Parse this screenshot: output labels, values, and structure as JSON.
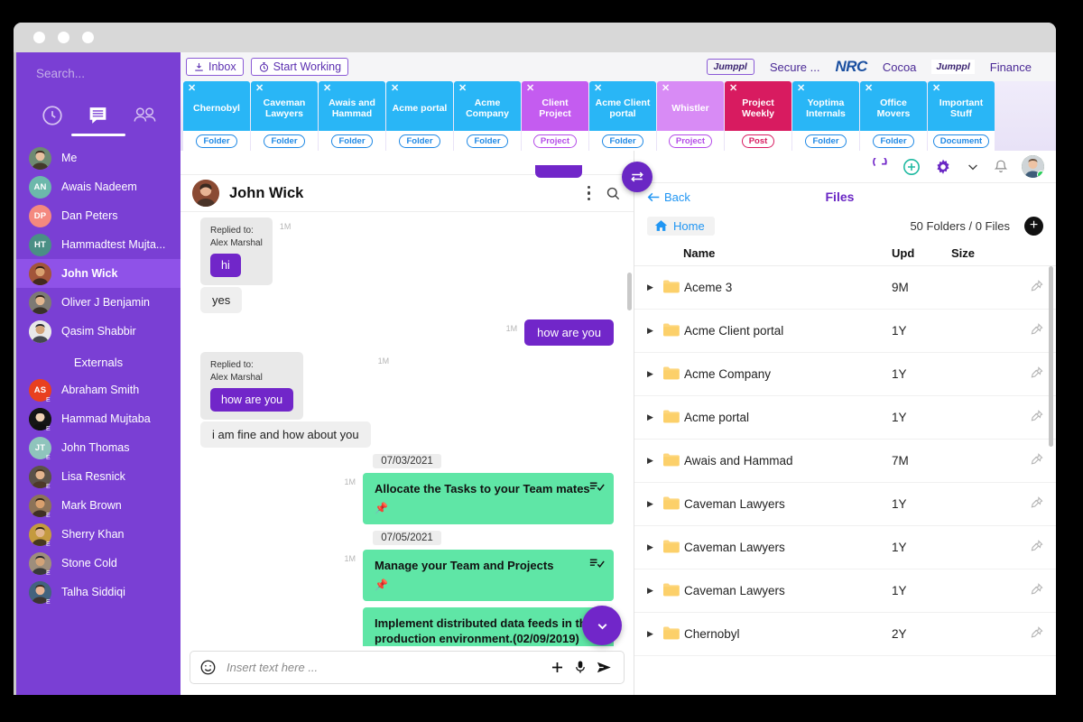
{
  "sidebar": {
    "search_placeholder": "Search...",
    "tabs": [
      {
        "name": "timer-tab",
        "label": "Timer"
      },
      {
        "name": "chat-tab",
        "label": "Chat",
        "active": true
      },
      {
        "name": "people-tab",
        "label": "People"
      }
    ],
    "contacts": [
      {
        "name": "Me",
        "initials": "",
        "color": "#6e8a72",
        "photo": true
      },
      {
        "name": "Awais Nadeem",
        "initials": "AN",
        "color": "#6cb8ab",
        "photo": false
      },
      {
        "name": "Dan Peters",
        "initials": "DP",
        "color": "#f4897f",
        "photo": false
      },
      {
        "name": "Hammadtest Mujta...",
        "initials": "HT",
        "color": "#4a8f85",
        "photo": false
      },
      {
        "name": "John Wick",
        "initials": "",
        "color": "#a2553a",
        "photo": true,
        "active": true
      },
      {
        "name": "Oliver J Benjamin",
        "initials": "",
        "color": "#7d7a74",
        "photo": true
      },
      {
        "name": "Qasim Shabbir",
        "initials": "",
        "color": "#e8e8e8",
        "photo": true
      }
    ],
    "externals_title": "Externals",
    "externals": [
      {
        "name": "Abraham Smith",
        "initials": "AS",
        "color": "#e8401f",
        "photo": false,
        "badge": "E"
      },
      {
        "name": "Hammad Mujtaba",
        "initials": "",
        "color": "#161616",
        "photo": true,
        "badge": "E"
      },
      {
        "name": "John Thomas",
        "initials": "JT",
        "color": "#8fc4bc",
        "photo": false,
        "badge": "E"
      },
      {
        "name": "Lisa Resnick",
        "initials": "",
        "color": "#5c5248",
        "photo": true,
        "badge": "E"
      },
      {
        "name": "Mark Brown",
        "initials": "",
        "color": "#8d7358",
        "photo": true,
        "badge": "E"
      },
      {
        "name": "Sherry Khan",
        "initials": "",
        "color": "#c49a3f",
        "photo": true,
        "badge": "E"
      },
      {
        "name": "Stone Cold",
        "initials": "",
        "color": "#9e8e7c",
        "photo": true,
        "badge": "E"
      },
      {
        "name": "Talha Siddiqi",
        "initials": "",
        "color": "#43637e",
        "photo": true,
        "badge": "E"
      }
    ]
  },
  "toolbar": {
    "inbox_label": "Inbox",
    "start_working_label": "Start Working",
    "brands": [
      {
        "text": "Jumppl",
        "style": "chip"
      },
      {
        "text": "Secure ...",
        "style": "plain-link"
      },
      {
        "text": "NRC",
        "style": "nrc"
      },
      {
        "text": "Cocoa",
        "style": "plain-link"
      },
      {
        "text": "Jumppl",
        "style": "white"
      },
      {
        "text": "Finance",
        "style": "plain-link"
      }
    ]
  },
  "doc_tabs": [
    {
      "title": "Chernobyl",
      "kind": "Folder",
      "color": "#29b6f6",
      "kind_color": "#1e88e5"
    },
    {
      "title": "Caveman Lawyers",
      "kind": "Folder",
      "color": "#29b6f6",
      "kind_color": "#1e88e5"
    },
    {
      "title": "Awais and Hammad",
      "kind": "Folder",
      "color": "#29b6f6",
      "kind_color": "#1e88e5"
    },
    {
      "title": "Acme portal",
      "kind": "Folder",
      "color": "#29b6f6",
      "kind_color": "#1e88e5"
    },
    {
      "title": "Acme Company",
      "kind": "Folder",
      "color": "#29b6f6",
      "kind_color": "#1e88e5"
    },
    {
      "title": "Client Project",
      "kind": "Project",
      "color": "#c45cf0",
      "kind_color": "#b44ae8"
    },
    {
      "title": "Acme Client portal",
      "kind": "Folder",
      "color": "#29b6f6",
      "kind_color": "#1e88e5"
    },
    {
      "title": "Whistler",
      "kind": "Project",
      "color": "#d88bf5",
      "kind_color": "#b44ae8"
    },
    {
      "title": "Project Weekly",
      "kind": "Post",
      "color": "#d81b60",
      "kind_color": "#d81b60"
    },
    {
      "title": "Yoptima Internals",
      "kind": "Folder",
      "color": "#29b6f6",
      "kind_color": "#1e88e5"
    },
    {
      "title": "Office Movers",
      "kind": "Folder",
      "color": "#29b6f6",
      "kind_color": "#1e88e5"
    },
    {
      "title": "Important Stuff",
      "kind": "Document",
      "color": "#29b6f6",
      "kind_color": "#1e88e5"
    }
  ],
  "chat": {
    "title": "John Wick",
    "messages": [
      {
        "type": "quote-reply",
        "dir": "in",
        "stamp": "1M",
        "reply_label": "Replied to:",
        "reply_name": "Alex Marshal",
        "quoted": "hi",
        "text": "yes"
      },
      {
        "type": "text",
        "dir": "out",
        "stamp": "1M",
        "text": "how are you"
      },
      {
        "type": "quote-reply",
        "dir": "in",
        "stamp": "1M",
        "reply_label": "Replied to:",
        "reply_name": "Alex Marshal",
        "quoted": "how are you",
        "text": "i am fine and how about you"
      },
      {
        "type": "date",
        "text": "07/03/2021"
      },
      {
        "type": "task",
        "dir": "out",
        "stamp": "1M",
        "text": "Allocate the Tasks to your Team mates"
      },
      {
        "type": "date",
        "text": "07/05/2021"
      },
      {
        "type": "task",
        "dir": "out",
        "stamp": "1M",
        "text": "Manage your Team and Projects"
      },
      {
        "type": "task",
        "dir": "out",
        "stamp": "",
        "text": "Implement distributed data feeds in the production environment.(02/09/2019)"
      }
    ],
    "composer_placeholder": "Insert text here ..."
  },
  "files": {
    "back_label": "Back",
    "title": "Files",
    "home_label": "Home",
    "count_label": "50 Folders / 0 Files",
    "columns": {
      "name": "Name",
      "upd": "Upd",
      "size": "Size"
    },
    "rows": [
      {
        "name": "Aceme 3",
        "upd": "9M",
        "size": ""
      },
      {
        "name": "Acme Client portal",
        "upd": "1Y",
        "size": ""
      },
      {
        "name": "Acme Company",
        "upd": "1Y",
        "size": ""
      },
      {
        "name": "Acme portal",
        "upd": "1Y",
        "size": ""
      },
      {
        "name": "Awais and Hammad",
        "upd": "7M",
        "size": ""
      },
      {
        "name": "Caveman Lawyers",
        "upd": "1Y",
        "size": ""
      },
      {
        "name": "Caveman Lawyers",
        "upd": "1Y",
        "size": ""
      },
      {
        "name": "Caveman Lawyers",
        "upd": "1Y",
        "size": ""
      },
      {
        "name": "Chernobyl",
        "upd": "2Y",
        "size": ""
      }
    ]
  },
  "colors": {
    "sidebar_purple": "#7a3fd4",
    "accent_purple": "#7126c9",
    "task_green": "#5fe6a6",
    "tab_blue": "#29b6f6",
    "link_blue": "#2196f3"
  }
}
